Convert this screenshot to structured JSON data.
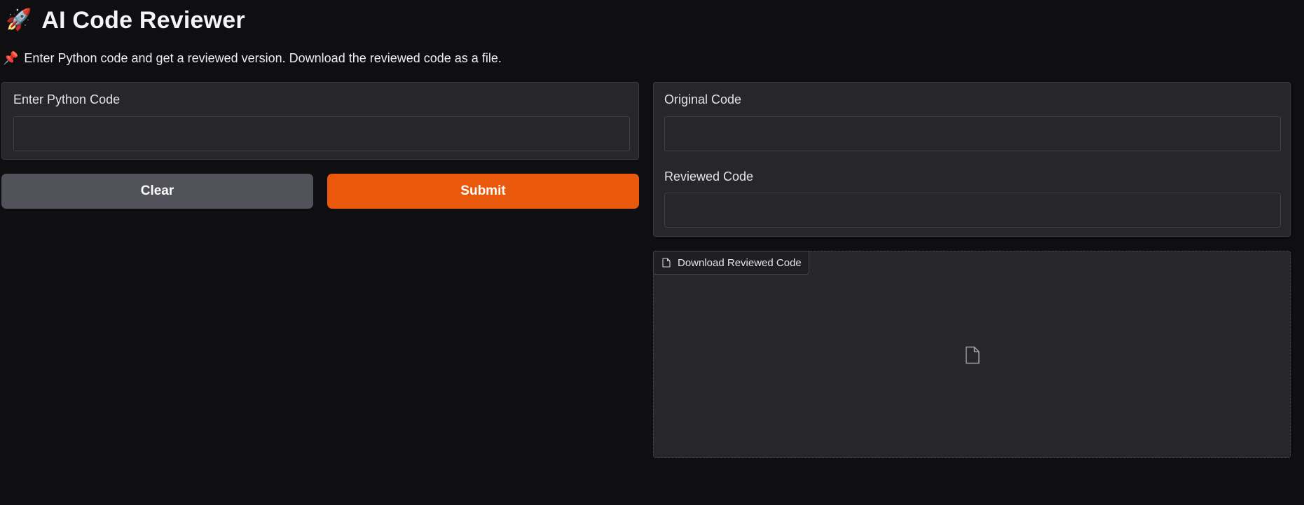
{
  "header": {
    "emoji": "🚀",
    "title": "AI Code Reviewer",
    "subtitle_icon": "📌",
    "subtitle": "Enter Python code and get a reviewed version. Download the reviewed code as a file."
  },
  "input_panel": {
    "label": "Enter Python Code",
    "value": "",
    "placeholder": ""
  },
  "buttons": {
    "clear_label": "Clear",
    "submit_label": "Submit"
  },
  "output_panel": {
    "original_label": "Original Code",
    "original_value": "",
    "reviewed_label": "Reviewed Code",
    "reviewed_value": ""
  },
  "download": {
    "label": "Download Reviewed Code",
    "tab_icon": "file-icon",
    "empty_icon": "file-icon"
  },
  "colors": {
    "background": "#0f0f11",
    "panel": "#27272a",
    "clear_button": "#52525b",
    "submit_button": "#ea580c"
  }
}
